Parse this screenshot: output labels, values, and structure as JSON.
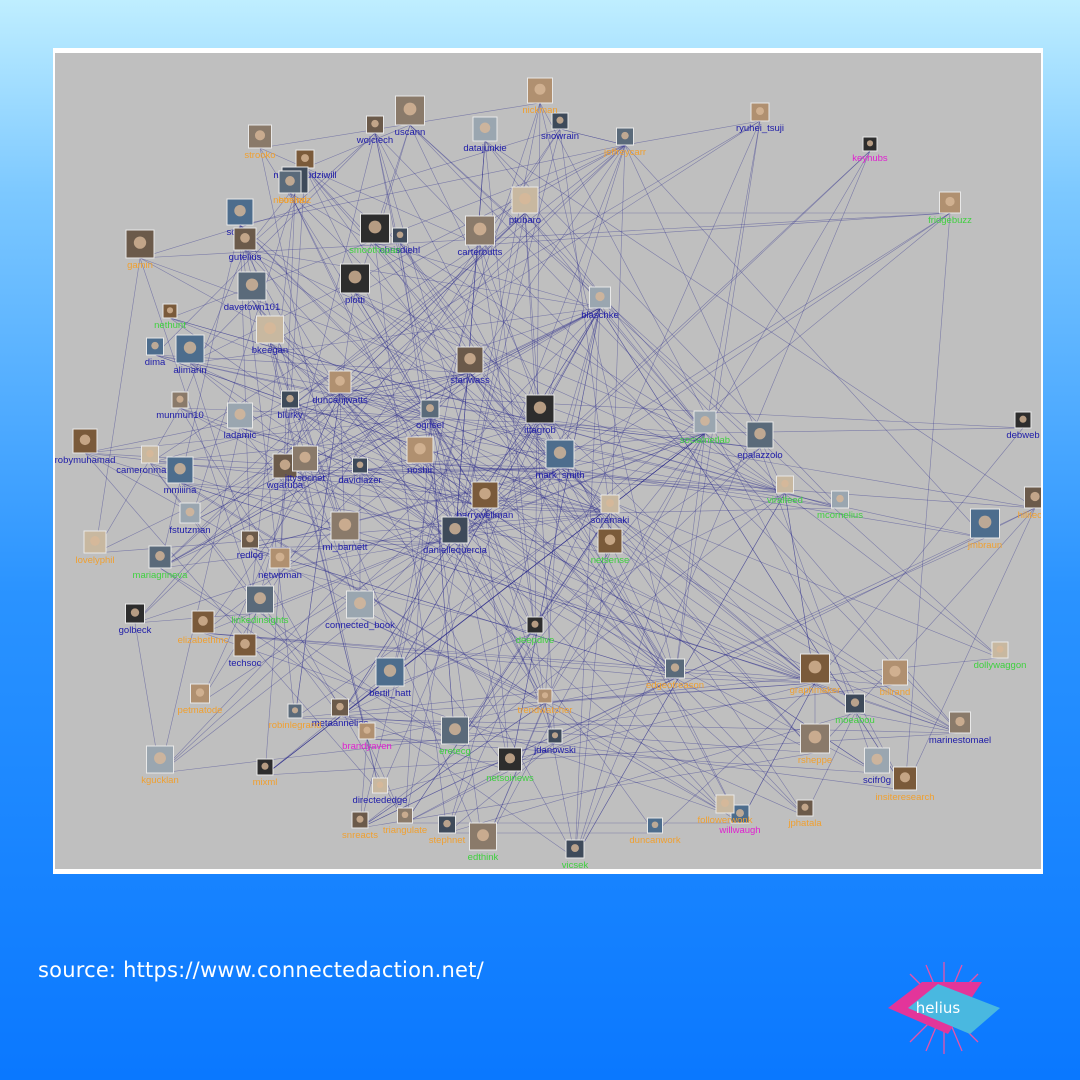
{
  "source": "source: https://www.connectedaction.net/",
  "logo_text": "helius",
  "colors": {
    "graph_bg": "#bfbfbf",
    "edge": "#2b2a8c",
    "label_blue": "#1d1ba8",
    "label_orange": "#f0a030",
    "label_green": "#3fd13f",
    "label_magenta": "#e020d0"
  },
  "nodes": [
    {
      "label": "wojciech",
      "color": "blue"
    },
    {
      "label": "uscann",
      "color": "blue"
    },
    {
      "label": "snowrain",
      "color": "blue"
    },
    {
      "label": "ryuhei_tsuji",
      "color": "blue"
    },
    {
      "label": "jeffreycarr",
      "color": "orange"
    },
    {
      "label": "keyhubs",
      "color": "magenta"
    },
    {
      "label": "datajunkie",
      "color": "blue"
    },
    {
      "label": "nicolasrudziwill",
      "color": "blue"
    },
    {
      "label": "ptubaro",
      "color": "blue"
    },
    {
      "label": "scotxc",
      "color": "blue"
    },
    {
      "label": "gutelius",
      "color": "blue"
    },
    {
      "label": "carterbutts",
      "color": "blue"
    },
    {
      "label": "chrisdiehl",
      "color": "blue"
    },
    {
      "label": "fridgebuzz",
      "color": "green"
    },
    {
      "label": "davetown101",
      "color": "blue"
    },
    {
      "label": "plotti",
      "color": "blue"
    },
    {
      "label": "blaschke",
      "color": "blue"
    },
    {
      "label": "nethunt",
      "color": "green"
    },
    {
      "label": "bkeegan",
      "color": "blue"
    },
    {
      "label": "alimarin",
      "color": "blue"
    },
    {
      "label": "stanwass",
      "color": "blue"
    },
    {
      "label": "munmun10",
      "color": "blue"
    },
    {
      "label": "blurky",
      "color": "blue"
    },
    {
      "label": "duncanjwatts",
      "color": "blue"
    },
    {
      "label": "ogrisel",
      "color": "blue"
    },
    {
      "label": "ittagrob",
      "color": "blue"
    },
    {
      "label": "ladamic",
      "color": "blue"
    },
    {
      "label": "robymuhamad",
      "color": "blue"
    },
    {
      "label": "cameronmarlow",
      "color": "blue"
    },
    {
      "label": "mmiiina",
      "color": "blue"
    },
    {
      "label": "wgaruba",
      "color": "blue"
    },
    {
      "label": "jttysocnet",
      "color": "blue"
    },
    {
      "label": "davidlazer",
      "color": "blue"
    },
    {
      "label": "noshir",
      "color": "blue"
    },
    {
      "label": "epalazzolo",
      "color": "blue"
    },
    {
      "label": "debweb",
      "color": "blue"
    },
    {
      "label": "fstutzman",
      "color": "blue"
    },
    {
      "label": "barrywellman",
      "color": "blue"
    },
    {
      "label": "soramaki",
      "color": "blue"
    },
    {
      "label": "mark_smith",
      "color": "blue"
    },
    {
      "label": "redlog",
      "color": "blue"
    },
    {
      "label": "ml_barnett",
      "color": "blue"
    },
    {
      "label": "daniellequercia",
      "color": "blue"
    },
    {
      "label": "netwoman",
      "color": "blue"
    },
    {
      "label": "mariagrineva",
      "color": "green"
    },
    {
      "label": "golbeck",
      "color": "blue"
    },
    {
      "label": "connected_book",
      "color": "blue"
    },
    {
      "label": "techsoc",
      "color": "blue"
    },
    {
      "label": "dollywaggon",
      "color": "green"
    },
    {
      "label": "bertil_hatt",
      "color": "blue"
    },
    {
      "label": "metaannelies",
      "color": "blue"
    },
    {
      "label": "marinestomael",
      "color": "blue"
    },
    {
      "label": "jdanowski",
      "color": "blue"
    },
    {
      "label": "brandyaven",
      "color": "magenta"
    },
    {
      "label": "eretecg",
      "color": "green"
    },
    {
      "label": "netsoinews",
      "color": "green"
    },
    {
      "label": "scifr0g",
      "color": "blue"
    },
    {
      "label": "insiteresearch",
      "color": "orange"
    },
    {
      "label": "directededge",
      "color": "blue"
    },
    {
      "label": "willwaugh",
      "color": "magenta"
    },
    {
      "label": "jphatala",
      "color": "orange"
    },
    {
      "label": "edthink",
      "color": "green"
    },
    {
      "label": "vicsek",
      "color": "green"
    },
    {
      "label": "trendwatcher",
      "color": "orange"
    },
    {
      "label": "edgeofreason",
      "color": "orange"
    },
    {
      "label": "deepdive",
      "color": "green"
    },
    {
      "label": "socialnetlab",
      "color": "green"
    },
    {
      "label": "graphmaker",
      "color": "orange"
    },
    {
      "label": "followerwonk",
      "color": "orange"
    },
    {
      "label": "duncanwork",
      "color": "orange"
    },
    {
      "label": "snreacts",
      "color": "orange"
    },
    {
      "label": "triangulate",
      "color": "orange"
    },
    {
      "label": "stephnet",
      "color": "orange"
    },
    {
      "label": "petmatode",
      "color": "orange"
    },
    {
      "label": "robinlegrand",
      "color": "orange"
    },
    {
      "label": "mixml",
      "color": "orange"
    },
    {
      "label": "kgucklan",
      "color": "orange"
    },
    {
      "label": "elizabethmc",
      "color": "orange"
    },
    {
      "label": "lovelyphil",
      "color": "orange"
    },
    {
      "label": "dima",
      "color": "blue"
    },
    {
      "label": "gamin",
      "color": "orange"
    },
    {
      "label": "strooko",
      "color": "orange"
    },
    {
      "label": "bosheiz",
      "color": "orange"
    },
    {
      "label": "nickman",
      "color": "orange"
    },
    {
      "label": "linkedinsights",
      "color": "green"
    },
    {
      "label": "smoothspan",
      "color": "green"
    },
    {
      "label": "mcornelius",
      "color": "green"
    },
    {
      "label": "netsense",
      "color": "green"
    },
    {
      "label": "viralfeed",
      "color": "green"
    },
    {
      "label": "jmbraun",
      "color": "orange"
    },
    {
      "label": "hilitecod",
      "color": "orange"
    },
    {
      "label": "rsheppe",
      "color": "orange"
    },
    {
      "label": "moeabou",
      "color": "green"
    },
    {
      "label": "billrand",
      "color": "orange"
    },
    {
      "label": "netmind",
      "color": "orange"
    }
  ]
}
